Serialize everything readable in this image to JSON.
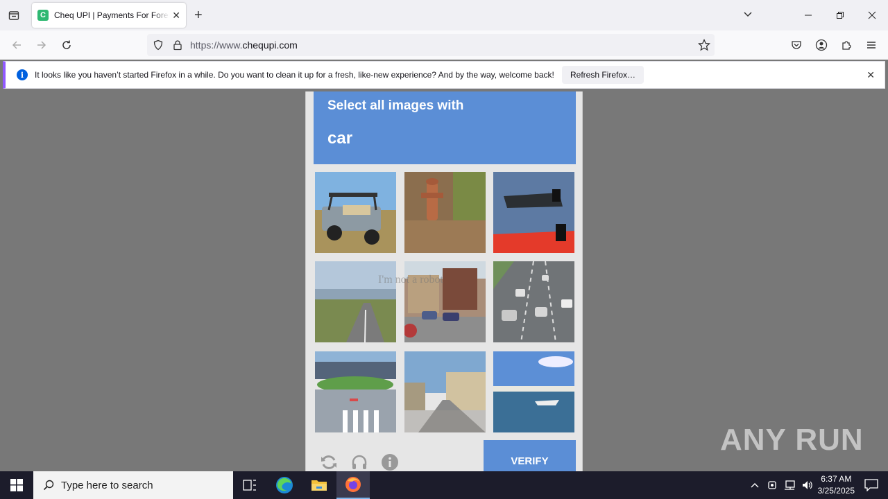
{
  "browser": {
    "tab_title": "Cheq UPI | Payments For Foreign",
    "tab_favicon_letter": "C",
    "url_prefix": "https://www.",
    "url_domain": "chequpi.com"
  },
  "notification": {
    "text": "It looks like you haven’t started Firefox in a while. Do you want to clean it up for a fresh, like-new experience? And by the way, welcome back!",
    "button_label": "Refresh Firefox…"
  },
  "captcha": {
    "instruction": "Select all images with",
    "target": "car",
    "tiles": [
      "golf-cart",
      "fire-hydrant",
      "boats",
      "coastal-road",
      "main-street-cars",
      "highway-cars",
      "crosswalk",
      "town-street",
      "sea-boat"
    ],
    "verify_label": "VERIFY",
    "underlay_text": "I'm not a robot"
  },
  "watermark": {
    "text": "ANY RUN"
  },
  "taskbar": {
    "search_placeholder": "Type here to search",
    "time": "6:37 AM",
    "date": "3/25/2025"
  }
}
